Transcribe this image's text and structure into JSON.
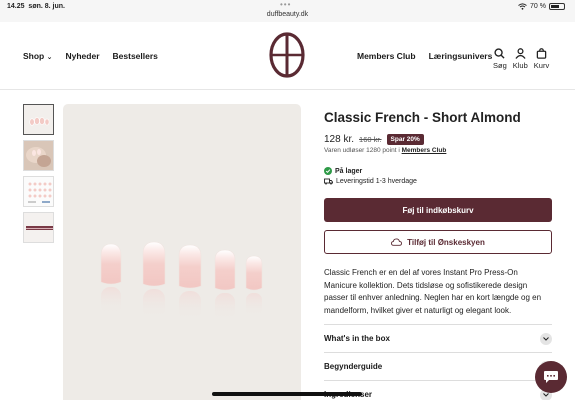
{
  "status": {
    "time": "14.25",
    "date": "søn. 8. jun.",
    "url": "duffbeauty.dk",
    "battery": "70 %",
    "battery_level": 0.7
  },
  "nav": {
    "left": [
      "Shop",
      "Nyheder",
      "Bestsellers"
    ],
    "right": [
      "Members Club",
      "Læringsunivers"
    ],
    "icons": [
      {
        "label": "Søg",
        "icon": "search-icon"
      },
      {
        "label": "Klub",
        "icon": "user-icon"
      },
      {
        "label": "Kurv",
        "icon": "bag-icon"
      }
    ]
  },
  "product": {
    "title": "Classic French - Short Almond",
    "price": "128 kr.",
    "old_price": "160 kr.",
    "badge": "Spar 20%",
    "points_prefix": "Varen udløser 1280 point i",
    "points_link": "Members Club",
    "stock": "På lager",
    "delivery": "Leveringstid 1-3 hverdage",
    "add_to_cart": "Føj til indkøbskurv",
    "wishlist": "Tilføj til Ønskeskyen",
    "description": "Classic French er en del af vores Instant Pro Press-On Manicure kollektion. Dets tidsløse og sofistikerede design passer til enhver anledning. Neglen har en kort længde og en mandelform, hvilket giver et naturligt og elegant look."
  },
  "accordion": [
    "What's in the box",
    "Begynderguide",
    "Ingredienser"
  ],
  "colors": {
    "brand": "#5a2a33",
    "image_bg": "#eeebe7",
    "green": "#2e9a47"
  }
}
